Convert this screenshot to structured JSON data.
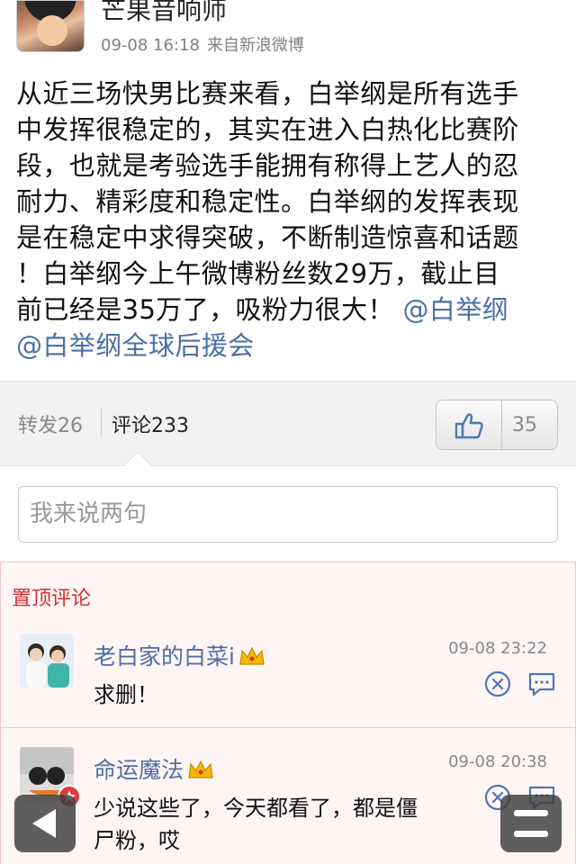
{
  "post": {
    "author": "芒果音响师",
    "time": "09-08 16:18",
    "source": "来自新浪微博",
    "lines": [
      "从近三场快男比赛来看，白举纲是所有选手",
      "中发挥很稳定的，其实在进入白热化比赛阶",
      "段，也就是考验选手能拥有称得上艺人的忍",
      "耐力、精彩度和稳定性。白举纲的发挥表现",
      "是在稳定中求得突破，不断制造惊喜和话题",
      "！白举纲今上午微博粉丝数29万，截止目",
      "前已经是35万了，吸粉力很大！"
    ],
    "mention1": "@白举纲",
    "mention2": "@白举纲全球后援会"
  },
  "actions": {
    "repost": "转发26",
    "comments": "评论233",
    "likes": "35"
  },
  "comment_box": {
    "placeholder": "我来说两句"
  },
  "pinned": {
    "title": "置顶评论",
    "comments": [
      {
        "name": "老白家的白菜i",
        "time": "09-08 23:22",
        "text": "求删！"
      },
      {
        "name": "命运魔法",
        "time": "09-08 20:38",
        "text_line1": "少说这些了，今天都看了，都是僵",
        "text_line2": "尸粉，哎"
      }
    ]
  },
  "icons": {
    "like": "thumbs-up-icon",
    "delete": "circle-x-icon",
    "reply": "speech-bubble-icon",
    "crown": "crown-icon",
    "back": "back-arrow-icon",
    "menu": "hamburger-menu-icon"
  },
  "colors": {
    "link": "#4a6fa8",
    "pinned_title": "#d43030",
    "pinned_bg": "#fff5f5"
  }
}
